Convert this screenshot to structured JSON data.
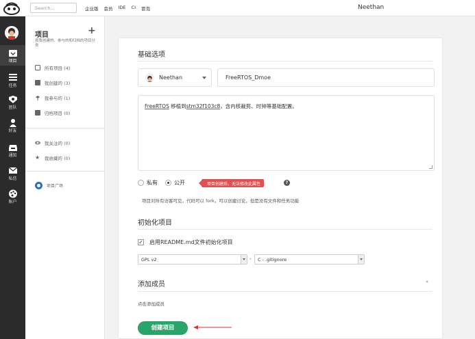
{
  "topbar": {
    "search_placeholder": "Search...",
    "nav": [
      "企业版",
      "会员",
      "IDE",
      "CI",
      "冒泡"
    ],
    "username": "Neethan"
  },
  "sidebar": {
    "items": [
      {
        "label": "项目",
        "icon": "project-icon",
        "active": true
      },
      {
        "label": "任务",
        "icon": "task-icon",
        "active": false
      },
      {
        "label": "团队",
        "icon": "team-icon",
        "active": false
      },
      {
        "label": "好友",
        "icon": "friend-icon",
        "active": false
      },
      {
        "label": "通知",
        "icon": "inbox-icon",
        "active": false
      },
      {
        "label": "私信",
        "icon": "mail-icon",
        "active": false
      },
      {
        "label": "账户",
        "icon": "palette-icon",
        "active": false
      }
    ]
  },
  "project_nav": {
    "title": "项目",
    "description": "按我创建的、参与的和归档的项目分类",
    "items": [
      {
        "label": "所有项目 (4)"
      },
      {
        "label": "我创建的 (3)"
      },
      {
        "label": "我参与的 (1)"
      },
      {
        "label": "归档项目 (0)"
      }
    ],
    "items2": [
      {
        "label": "我关注的 (0)"
      },
      {
        "label": "我收藏的 (0)"
      }
    ],
    "plaza": "项目广场"
  },
  "form": {
    "basic_title": "基础选项",
    "owner": "Neethan",
    "project_name": "FreeRTOS_Dmoe",
    "description_parts": [
      "FreeRTOS",
      " 移植到",
      "stm32f103c8",
      "，含内核裁剪、时钟等基础配置。"
    ],
    "visibility": {
      "private_label": "私有",
      "public_label": "公开",
      "selected": "公开"
    },
    "warning": "项目创建后，无法修改此属性",
    "hint": "项目对所有访客可见，代码可以 fork，可以创建讨论，但是没有文件和任务功能",
    "init_title": "初始化项目",
    "readme_label": "启用README.md文件初始化项目",
    "readme_checked": true,
    "license": "GPL v2",
    "gitignore": "C - .gitignore",
    "separator": "-",
    "members_title": "添加成员",
    "collapse_symbol": "»",
    "add_members_hint": "点击添加成员",
    "create_button": "创建项目"
  },
  "colors": {
    "primary_green": "#2aa56a",
    "warning_red": "#e05050",
    "sidebar_dark": "#2b2b2b",
    "plaza_blue": "#2d6fb7"
  }
}
